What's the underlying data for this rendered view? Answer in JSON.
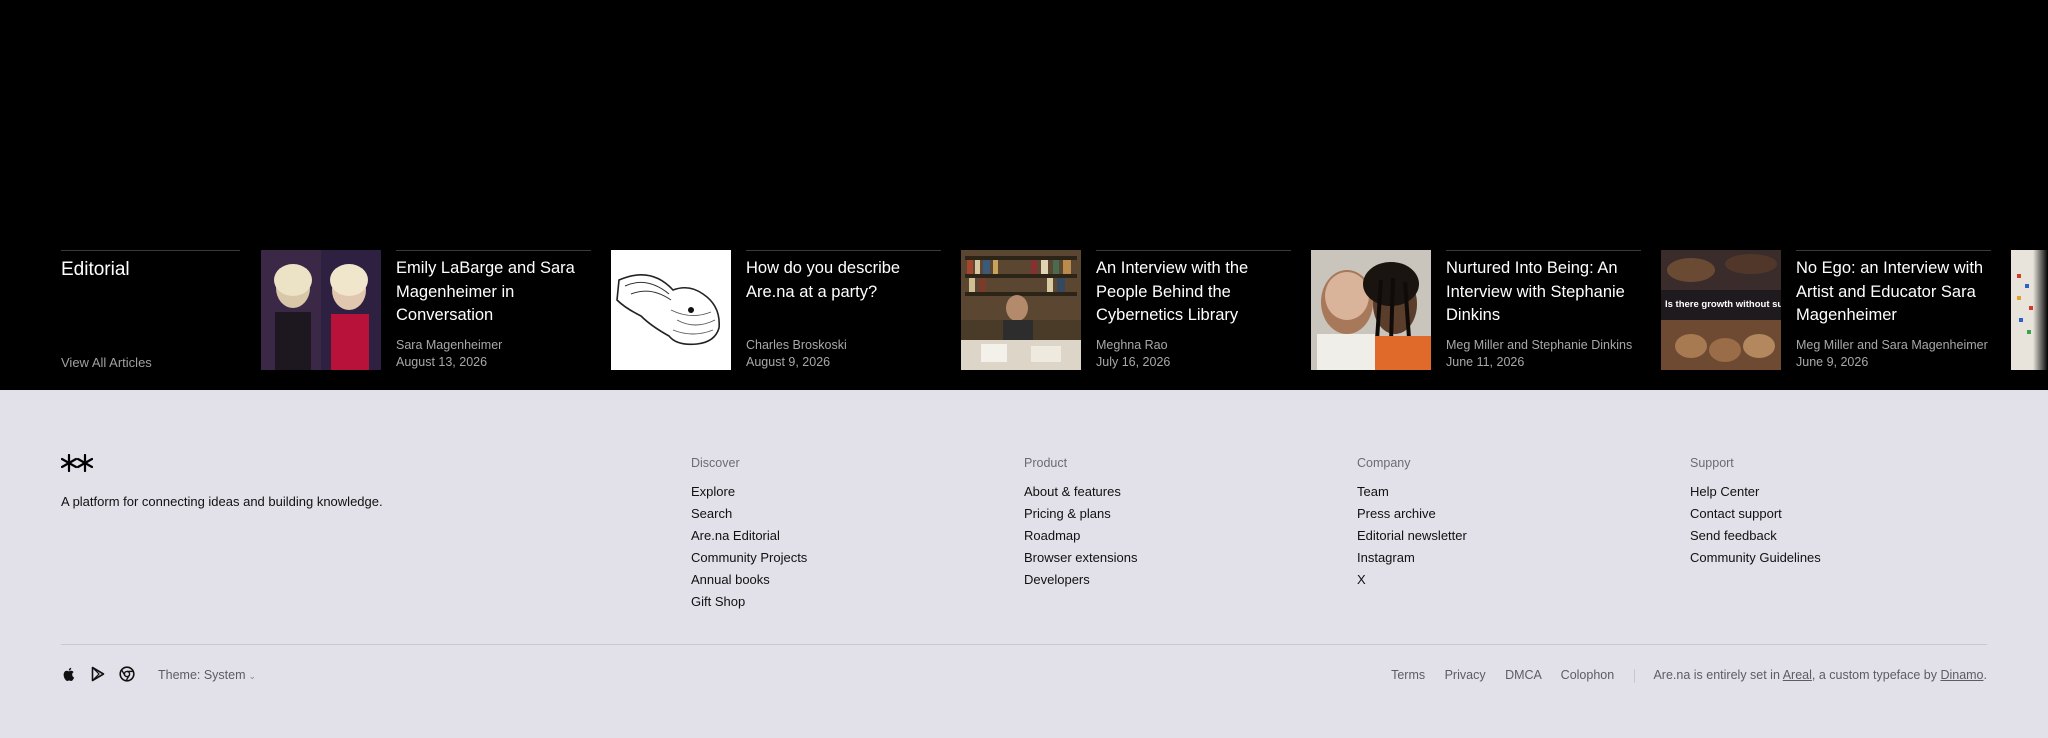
{
  "editorial": {
    "heading": "Editorial",
    "view_all": "View All Articles",
    "articles": [
      {
        "title": "Emily LaBarge and Sara Magenheimer in Conversation",
        "author": "Sara Magenheimer",
        "date": "August 13, 2026"
      },
      {
        "title": "How do you describe Are.na at a party?",
        "author": "Charles Broskoski",
        "date": "August 9, 2026"
      },
      {
        "title": "An Interview with the People Behind the Cybernetics Library",
        "author": "Meghna Rao",
        "date": "July 16, 2026"
      },
      {
        "title": "Nurtured Into Being: An Interview with Stephanie Dinkins",
        "author": "Meg Miller and Stephanie Dinkins",
        "date": "June 11, 2026"
      },
      {
        "title": "No Ego: an Interview with Artist and Educator Sara Magenheimer",
        "author": "Meg Miller and Sara Magenheimer",
        "date": "June 9, 2026",
        "thumb_caption": "Is there growth without suffering?"
      }
    ]
  },
  "footer": {
    "tagline": "A platform for connecting ideas and building knowledge.",
    "columns": [
      {
        "heading": "Discover",
        "links": [
          "Explore",
          "Search",
          "Are.na Editorial",
          "Community Projects",
          "Annual books",
          "Gift Shop"
        ]
      },
      {
        "heading": "Product",
        "links": [
          "About & features",
          "Pricing & plans",
          "Roadmap",
          "Browser extensions",
          "Developers"
        ]
      },
      {
        "heading": "Company",
        "links": [
          "Team",
          "Press archive",
          "Editorial newsletter",
          "Instagram",
          "X"
        ]
      },
      {
        "heading": "Support",
        "links": [
          "Help Center",
          "Contact support",
          "Send feedback",
          "Community Guidelines"
        ]
      }
    ],
    "theme_label": "Theme: System",
    "legal_links": [
      "Terms",
      "Privacy",
      "DMCA",
      "Colophon"
    ],
    "credit": {
      "prefix": "Are.na is entirely set in ",
      "font_name": "Areal",
      "middle": ", a custom typeface by ",
      "foundry": "Dinamo",
      "suffix": "."
    }
  },
  "icons": [
    "apple-icon",
    "google-play-icon",
    "chrome-icon"
  ],
  "colors": {
    "band_bg": "#000000",
    "footer_bg": "#e2e0e9",
    "muted_text": "#a8a8a8"
  }
}
